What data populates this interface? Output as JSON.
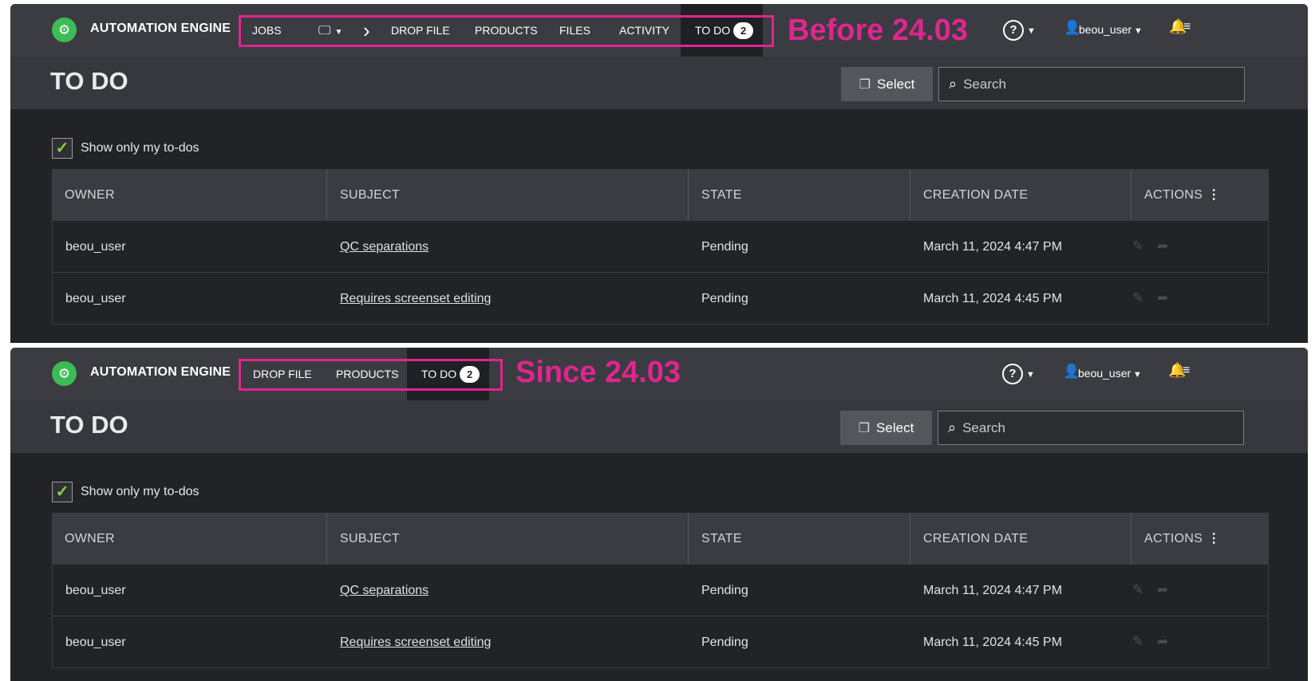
{
  "before": {
    "app_title": "AUTOMATION ENGINE",
    "nav": [
      {
        "label": "JOBS"
      },
      {
        "label": ""
      },
      {
        "label": "DROP FILE"
      },
      {
        "label": "PRODUCTS"
      },
      {
        "label": "FILES"
      },
      {
        "label": "ACTIVITY"
      },
      {
        "label": "TO DO",
        "badge": "2",
        "active": true
      }
    ],
    "highlight_label": "Before 24.03",
    "help_label": "?",
    "user": "beou_user",
    "page_title": "TO DO",
    "select_label": "Select",
    "search_placeholder": "Search",
    "filter_label": "Show only my to-dos",
    "columns": [
      "OWNER",
      "SUBJECT",
      "STATE",
      "CREATION DATE",
      "ACTIONS"
    ],
    "rows": [
      {
        "owner": "beou_user",
        "subject": "QC separations",
        "state": "Pending",
        "date": "March 11, 2024 4:47 PM"
      },
      {
        "owner": "beou_user",
        "subject": "Requires screenset editing",
        "state": "Pending",
        "date": "March 11, 2024 4:45 PM"
      }
    ]
  },
  "since": {
    "app_title": "AUTOMATION ENGINE",
    "nav": [
      {
        "label": "DROP FILE"
      },
      {
        "label": "PRODUCTS"
      },
      {
        "label": "TO DO",
        "badge": "2",
        "active": true
      }
    ],
    "highlight_label": "Since 24.03",
    "help_label": "?",
    "user": "beou_user",
    "page_title": "TO DO",
    "select_label": "Select",
    "search_placeholder": "Search",
    "filter_label": "Show only my to-dos",
    "columns": [
      "OWNER",
      "SUBJECT",
      "STATE",
      "CREATION DATE",
      "ACTIONS"
    ],
    "rows": [
      {
        "owner": "beou_user",
        "subject": "QC separations",
        "state": "Pending",
        "date": "March 11, 2024 4:47 PM"
      },
      {
        "owner": "beou_user",
        "subject": "Requires screenset editing",
        "state": "Pending",
        "date": "March 11, 2024 4:45 PM"
      }
    ]
  },
  "colors": {
    "accent_highlight": "#e0258f",
    "logo_green": "#3dbb55",
    "check_green": "#8bd13f"
  },
  "icons": [
    "gear-logo-icon",
    "monitor-icon",
    "chevron-right-icon",
    "help-icon",
    "user-icon",
    "bell-icon",
    "select-icon",
    "search-icon",
    "check-icon",
    "kebab-icon",
    "edit-icon",
    "forward-icon"
  ]
}
